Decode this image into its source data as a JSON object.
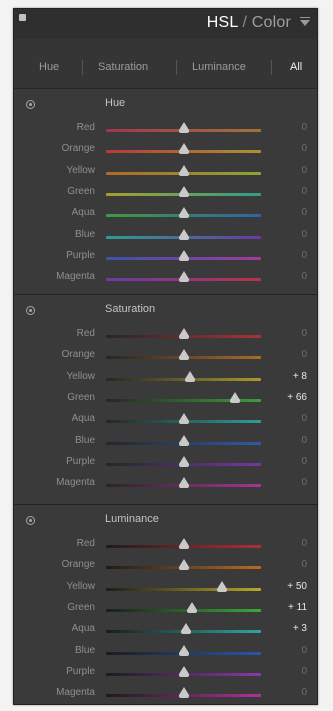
{
  "header": {
    "title_bold": "HSL",
    "title_sep": " / ",
    "title_rest": "Color"
  },
  "tabs": [
    {
      "label": "Hue",
      "active": false
    },
    {
      "label": "Saturation",
      "active": false
    },
    {
      "label": "Luminance",
      "active": false
    },
    {
      "label": "All",
      "active": true
    }
  ],
  "sections": [
    {
      "title": "Hue",
      "rows": [
        {
          "label": "Red",
          "value": "0",
          "level": 0,
          "colors": [
            "#a2354e",
            "#a0733a"
          ]
        },
        {
          "label": "Orange",
          "value": "0",
          "level": 0,
          "colors": [
            "#b83838",
            "#a89432"
          ]
        },
        {
          "label": "Yellow",
          "value": "0",
          "level": 0,
          "colors": [
            "#b06a28",
            "#8aa632"
          ]
        },
        {
          "label": "Green",
          "value": "0",
          "level": 0,
          "colors": [
            "#a6a02e",
            "#2e9e8a"
          ]
        },
        {
          "label": "Aqua",
          "value": "0",
          "level": 0,
          "colors": [
            "#3e9c3c",
            "#2c64a8"
          ]
        },
        {
          "label": "Blue",
          "value": "0",
          "level": 0,
          "colors": [
            "#2e9c94",
            "#6a3aa0"
          ]
        },
        {
          "label": "Purple",
          "value": "0",
          "level": 0,
          "colors": [
            "#3c52a8",
            "#9e3c9e"
          ]
        },
        {
          "label": "Magenta",
          "value": "0",
          "level": 0,
          "colors": [
            "#6a3aaa",
            "#b8324a"
          ]
        }
      ]
    },
    {
      "title": "Saturation",
      "rows": [
        {
          "label": "Red",
          "value": "0",
          "level": 0,
          "colors": [
            "#262626",
            "#a8333a"
          ]
        },
        {
          "label": "Orange",
          "value": "0",
          "level": 0,
          "colors": [
            "#262626",
            "#a86a2a"
          ]
        },
        {
          "label": "Yellow",
          "value": "+ 8",
          "level": 8,
          "colors": [
            "#262626",
            "#a89a2a"
          ]
        },
        {
          "label": "Green",
          "value": "+ 66",
          "level": 66,
          "colors": [
            "#262626",
            "#3c9e3a"
          ]
        },
        {
          "label": "Aqua",
          "value": "0",
          "level": 0,
          "colors": [
            "#262626",
            "#2c9e96"
          ]
        },
        {
          "label": "Blue",
          "value": "0",
          "level": 0,
          "colors": [
            "#262626",
            "#2e5aa8"
          ]
        },
        {
          "label": "Purple",
          "value": "0",
          "level": 0,
          "colors": [
            "#262626",
            "#7438a6"
          ]
        },
        {
          "label": "Magenta",
          "value": "0",
          "level": 0,
          "colors": [
            "#262626",
            "#a83494"
          ]
        }
      ]
    },
    {
      "title": "Luminance",
      "rows": [
        {
          "label": "Red",
          "value": "0",
          "level": 0,
          "colors": [
            "#1c1c1c",
            "#b02e36"
          ]
        },
        {
          "label": "Orange",
          "value": "0",
          "level": 0,
          "colors": [
            "#1c1c1c",
            "#b86a24"
          ]
        },
        {
          "label": "Yellow",
          "value": "+ 50",
          "level": 50,
          "colors": [
            "#1c1c1c",
            "#b8a82a"
          ]
        },
        {
          "label": "Green",
          "value": "+ 11",
          "level": 11,
          "colors": [
            "#1c1c1c",
            "#3ca83a"
          ]
        },
        {
          "label": "Aqua",
          "value": "+ 3",
          "level": 3,
          "colors": [
            "#1c1c1c",
            "#2ca8a0"
          ]
        },
        {
          "label": "Blue",
          "value": "0",
          "level": 0,
          "colors": [
            "#1c1c1c",
            "#2a56ac"
          ]
        },
        {
          "label": "Purple",
          "value": "0",
          "level": 0,
          "colors": [
            "#1c1c1c",
            "#8a3aa8"
          ]
        },
        {
          "label": "Magenta",
          "value": "0",
          "level": 0,
          "colors": [
            "#1c1c1c",
            "#b0309a"
          ]
        }
      ]
    }
  ],
  "icons": {
    "grip": "panel-grip-icon",
    "collapse": "collapse-triangle-icon",
    "target": "targeted-adjustment-icon"
  },
  "colors": {
    "panel_bg": "#3a3a3a",
    "thumb": "#c9c9c9",
    "value_nonzero": "#e8e8e8",
    "value_zero": "#6f6f6f"
  }
}
